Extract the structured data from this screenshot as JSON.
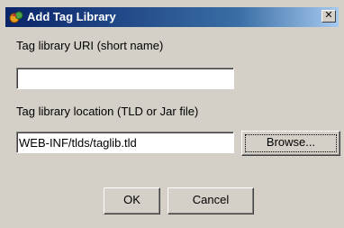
{
  "window": {
    "title": "Add Tag Library",
    "close_glyph": "✕"
  },
  "form": {
    "uri_label": "Tag library URI (short name)",
    "uri_value": "",
    "location_label": "Tag library location (TLD or Jar file)",
    "location_value": "WEB-INF/tlds/taglib.tld",
    "browse_label": "Browse..."
  },
  "footer": {
    "ok_label": "OK",
    "cancel_label": "Cancel"
  },
  "icons": {
    "app": "tag-library-icon",
    "close": "close-icon"
  }
}
